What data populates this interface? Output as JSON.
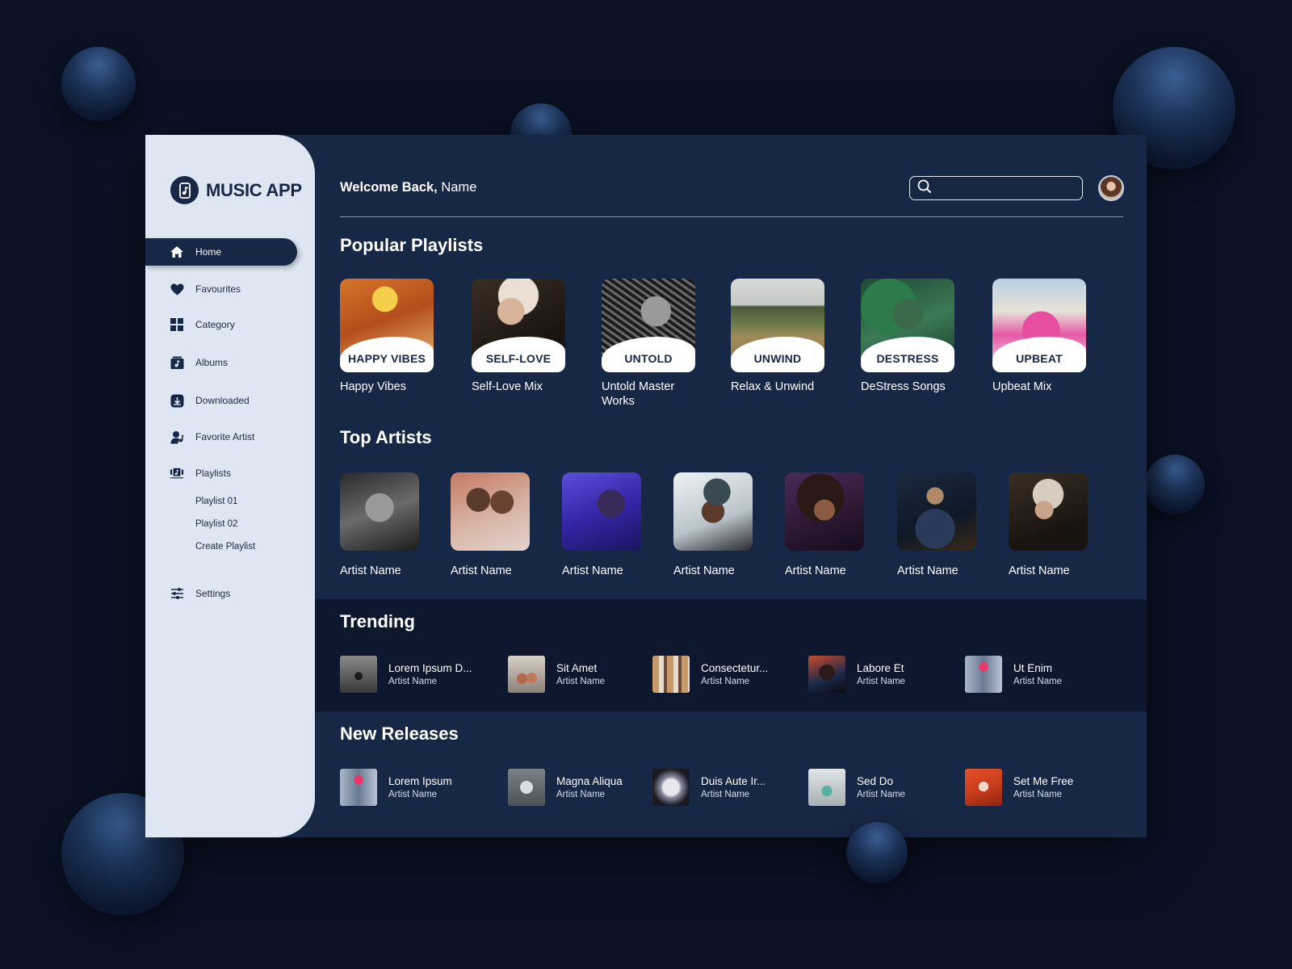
{
  "app": {
    "title": "MUSIC APP"
  },
  "sidebar": {
    "items": [
      {
        "label": "Home",
        "icon": "home-icon"
      },
      {
        "label": "Favourites",
        "icon": "heart-icon"
      },
      {
        "label": "Category",
        "icon": "grid-icon"
      },
      {
        "label": "Albums",
        "icon": "album-icon"
      },
      {
        "label": "Downloaded",
        "icon": "download-icon"
      },
      {
        "label": "Favorite Artist",
        "icon": "artist-icon"
      },
      {
        "label": "Playlists",
        "icon": "playlists-icon"
      },
      {
        "label": "Settings",
        "icon": "sliders-icon"
      }
    ],
    "playlists": [
      "Playlist 01",
      "Playlist 02",
      "Create Playlist"
    ]
  },
  "header": {
    "welcome_bold": "Welcome Back,",
    "welcome_name": "Name",
    "search_placeholder": ""
  },
  "sections": {
    "popular": "Popular Playlists",
    "artists": "Top Artists",
    "trending": "Trending",
    "new_releases": "New Releases"
  },
  "playlists": [
    {
      "tag": "HAPPY VIBES",
      "name": "Happy Vibes"
    },
    {
      "tag": "SELF-LOVE",
      "name": "Self-Love Mix"
    },
    {
      "tag": "UNTOLD",
      "name": "Untold Master Works"
    },
    {
      "tag": "UNWIND",
      "name": "Relax & Unwind"
    },
    {
      "tag": "DESTRESS",
      "name": "DeStress Songs"
    },
    {
      "tag": "UPBEAT",
      "name": "Upbeat Mix"
    }
  ],
  "artists": [
    "Artist Name",
    "Artist Name",
    "Artist Name",
    "Artist Name",
    "Artist Name",
    "Artist Name",
    "Artist Name"
  ],
  "trending": [
    {
      "title": "Lorem Ipsum D...",
      "artist": "Artist Name"
    },
    {
      "title": "Sit Amet",
      "artist": "Artist Name"
    },
    {
      "title": "Consectetur...",
      "artist": "Artist Name"
    },
    {
      "title": "Labore Et",
      "artist": "Artist Name"
    },
    {
      "title": "Ut Enim",
      "artist": "Artist Name"
    }
  ],
  "new_releases": [
    {
      "title": "Lorem Ipsum",
      "artist": "Artist Name"
    },
    {
      "title": "Magna Aliqua",
      "artist": "Artist Name"
    },
    {
      "title": "Duis Aute Ir...",
      "artist": "Artist Name"
    },
    {
      "title": "Sed Do",
      "artist": "Artist Name"
    },
    {
      "title": "Set Me Free",
      "artist": "Artist Name"
    }
  ],
  "colors": {
    "background": "#0a1224",
    "panel": "#172746",
    "sidebar": "#dde6f1",
    "text": "#ffffff"
  }
}
